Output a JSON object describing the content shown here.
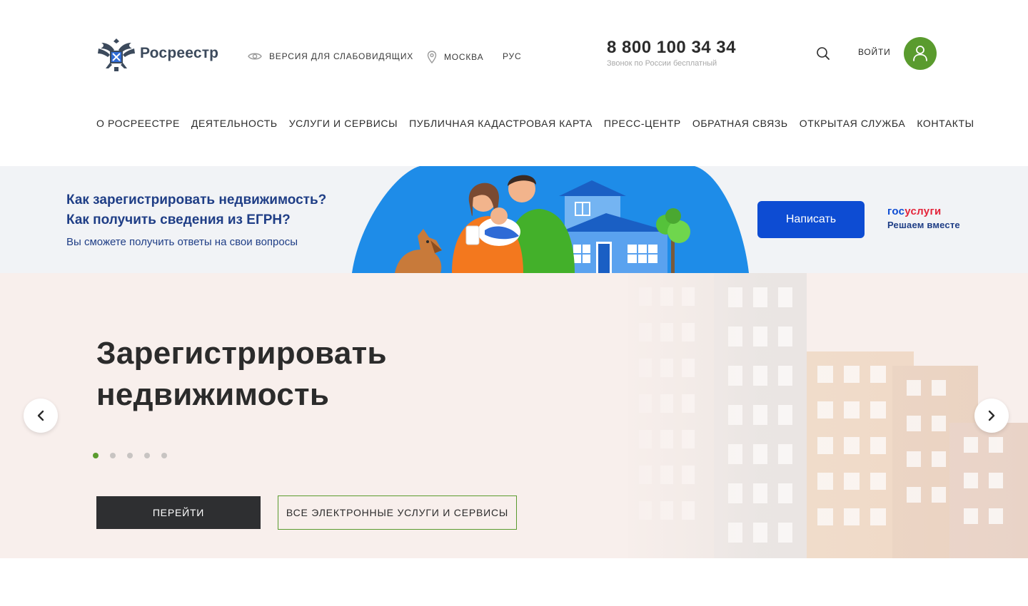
{
  "header": {
    "logo_text": "Росреестр",
    "accessibility_label": "ВЕРСИЯ ДЛЯ СЛАБОВИДЯЩИХ",
    "region_label": "МОСКВА",
    "language_label": "РУС",
    "phone_number": "8 800 100 34 34",
    "phone_note": "Звонок по России бесплатный",
    "login_label": "ВОЙТИ"
  },
  "nav": {
    "items": [
      "О РОСРЕЕСТРЕ",
      "ДЕЯТЕЛЬНОСТЬ",
      "УСЛУГИ И СЕРВИСЫ",
      "ПУБЛИЧНАЯ КАДАСТРОВАЯ КАРТА",
      "ПРЕСС-ЦЕНТР",
      "ОБРАТНАЯ СВЯЗЬ",
      "ОТКРЫТАЯ СЛУЖБА",
      "КОНТАКТЫ"
    ]
  },
  "promo": {
    "title_line1": "Как зарегистрировать недвижимость?",
    "title_line2": "Как получить сведения из ЕГРН?",
    "subtitle": "Вы сможете получить ответы на свои вопросы",
    "button_label": "Написать",
    "gosuslugi_brand_part1": "гос",
    "gosuslugi_brand_part2": "услуги",
    "gosuslugi_tagline": "Решаем вместе"
  },
  "hero": {
    "title_line1": "Зарегистрировать",
    "title_line2": "недвижимость",
    "slides_total": 5,
    "active_slide": 1,
    "primary_button": "ПЕРЕЙТИ",
    "secondary_button": "ВСЕ ЭЛЕКТРОННЫЕ УСЛУГИ И СЕРВИСЫ"
  },
  "colors": {
    "accent_green": "#5a9b2e",
    "gosuslugi_blue": "#0d4cd3",
    "gosuslugi_red": "#e4253b",
    "promo_text": "#1f3e86",
    "hero_bg": "#f8efec"
  },
  "icons": {
    "logo": "double-headed-eagle-icon",
    "accessibility": "eye-icon",
    "region": "location-pin-icon",
    "search": "search-icon",
    "login": "user-icon",
    "prev": "chevron-left-icon",
    "next": "chevron-right-icon"
  }
}
